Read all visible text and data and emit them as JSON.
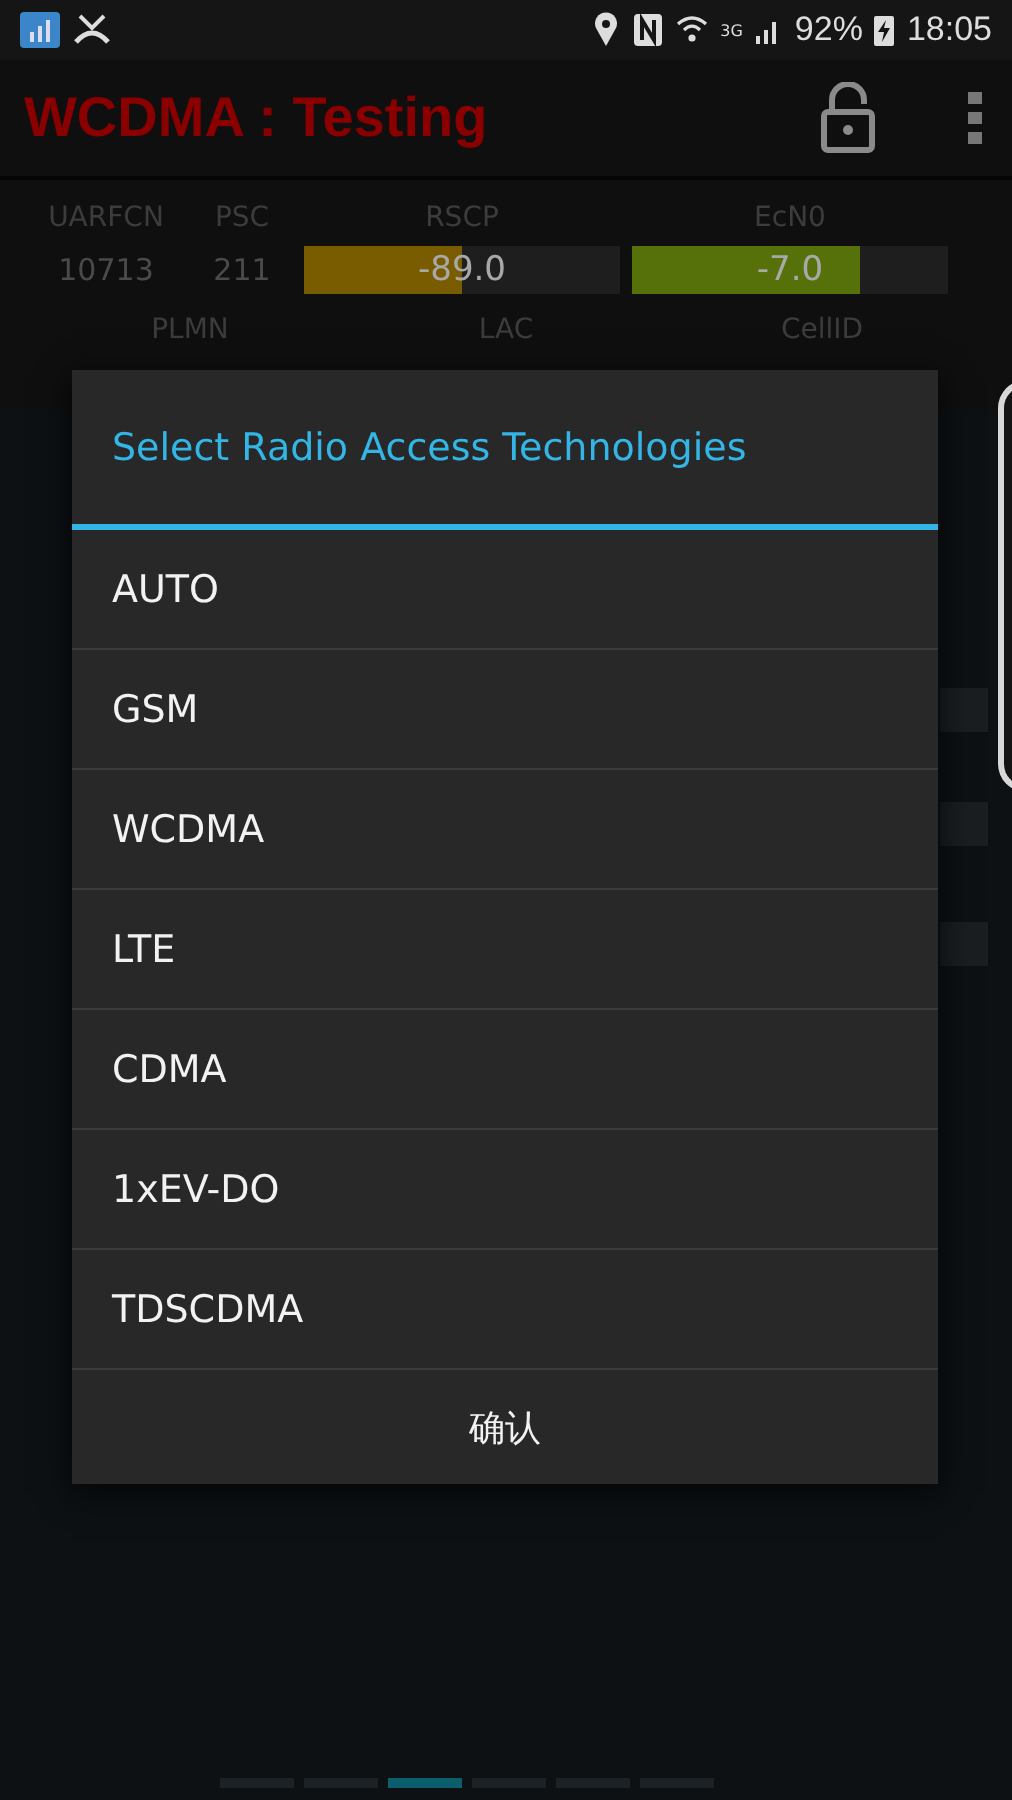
{
  "status_bar": {
    "network_type": "3G",
    "battery": "92%",
    "time": "18:05"
  },
  "app_bar": {
    "title": "WCDMA : Testing"
  },
  "info": {
    "headers": [
      "UARFCN",
      "PSC",
      "RSCP",
      "EcN0"
    ],
    "values": [
      "10713",
      "211"
    ],
    "gauges": [
      {
        "reading": "-89.0",
        "level": 0.5,
        "color": "#7a5c00"
      },
      {
        "reading": "-7.0",
        "level": 0.72,
        "color": "#56700a"
      }
    ],
    "headers_2": [
      "PLMN",
      "LAC",
      "CellID"
    ]
  },
  "dialog": {
    "title": "Select Radio Access Technologies",
    "options": [
      "AUTO",
      "GSM",
      "WCDMA",
      "LTE",
      "CDMA",
      "1xEV-DO",
      "TDSCDMA"
    ],
    "button": "确认"
  },
  "pages": [
    {
      "selected": false
    },
    {
      "selected": false
    },
    {
      "selected": true
    },
    {
      "selected": false
    },
    {
      "selected": false
    },
    {
      "selected": false
    }
  ]
}
